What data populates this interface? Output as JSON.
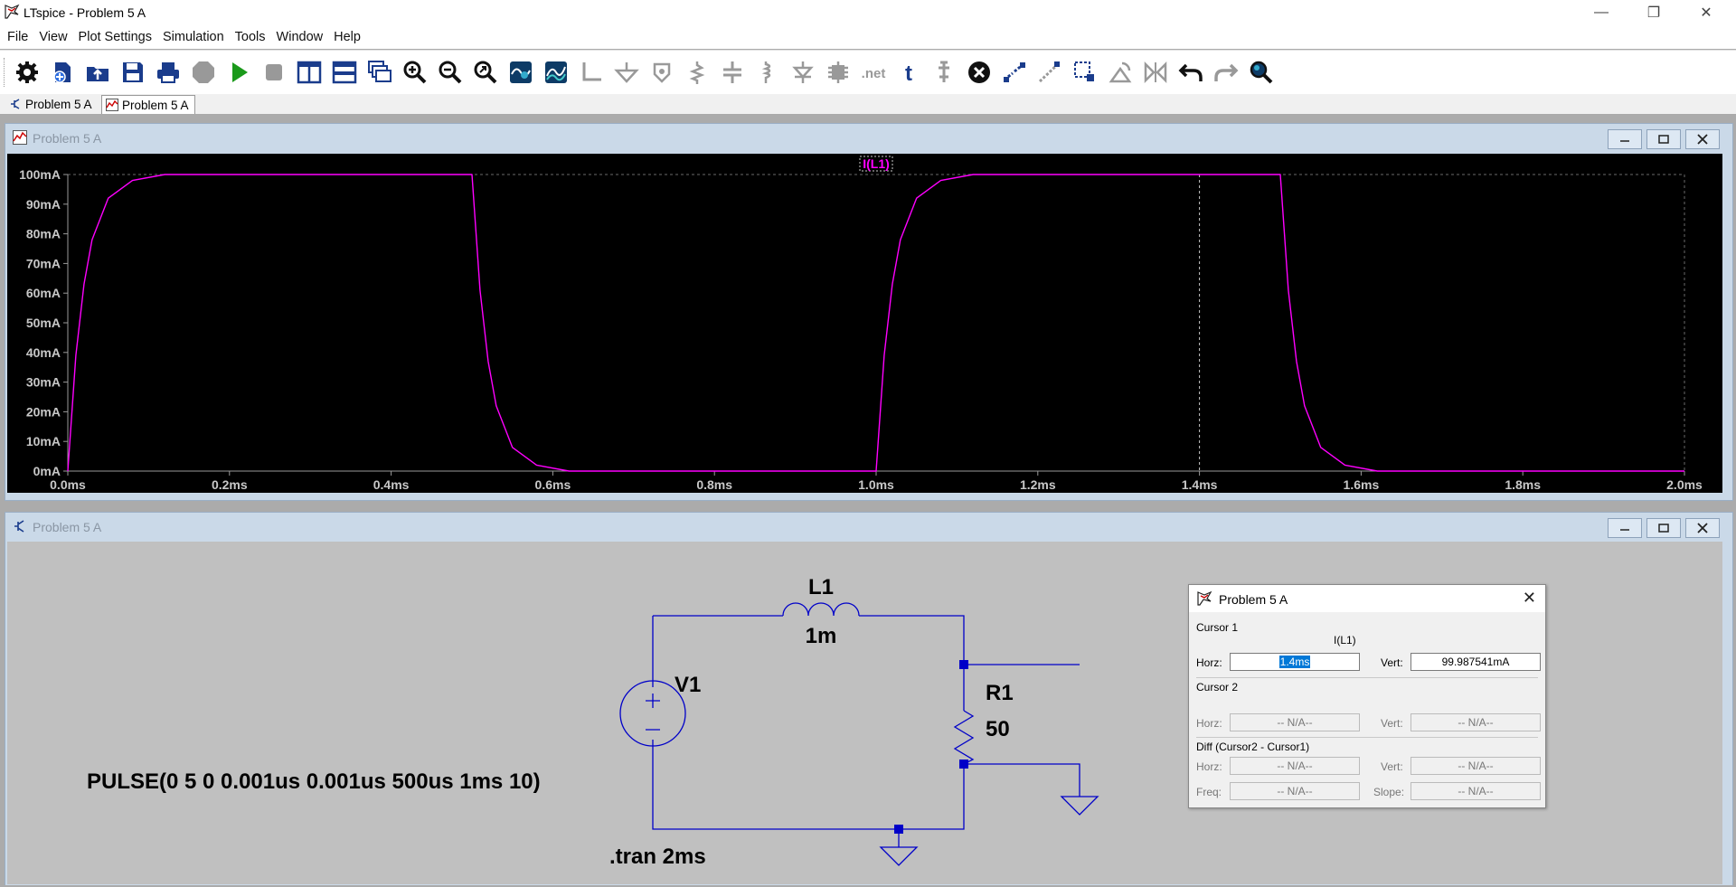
{
  "window": {
    "title": "LTspice - Problem 5 A"
  },
  "menu": [
    "File",
    "View",
    "Plot Settings",
    "Simulation",
    "Tools",
    "Window",
    "Help"
  ],
  "tabs": [
    {
      "label": "Problem 5 A",
      "kind": "schematic"
    },
    {
      "label": "Problem 5 A",
      "kind": "waveform",
      "active": true
    }
  ],
  "plot_window": {
    "title": "Problem 5 A"
  },
  "schematic_window": {
    "title": "Problem 5 A"
  },
  "chart_data": {
    "type": "line",
    "trace_label": "I(L1)",
    "trace_color": "#ff00ff",
    "background": "#000000",
    "xlabel": "",
    "ylabel": "",
    "xlim": [
      0,
      2.0
    ],
    "ylim": [
      0,
      100
    ],
    "x_ticks": [
      "0.0ms",
      "0.2ms",
      "0.4ms",
      "0.6ms",
      "0.8ms",
      "1.0ms",
      "1.2ms",
      "1.4ms",
      "1.6ms",
      "1.8ms",
      "2.0ms"
    ],
    "y_ticks": [
      "0mA",
      "10mA",
      "20mA",
      "30mA",
      "40mA",
      "50mA",
      "60mA",
      "70mA",
      "80mA",
      "90mA",
      "100mA"
    ],
    "cursor_x": 1.4,
    "series": [
      {
        "name": "I(L1)",
        "x_unit": "ms",
        "y_unit": "mA",
        "x": [
          0.0,
          0.01,
          0.02,
          0.03,
          0.05,
          0.08,
          0.12,
          0.5,
          0.51,
          0.52,
          0.53,
          0.55,
          0.58,
          0.62,
          1.0,
          1.01,
          1.02,
          1.03,
          1.05,
          1.08,
          1.12,
          1.5,
          1.51,
          1.52,
          1.53,
          1.55,
          1.58,
          1.62,
          2.0
        ],
        "y": [
          0,
          39,
          63,
          78,
          92,
          98,
          100,
          100,
          61,
          37,
          22,
          8,
          2,
          0,
          0,
          39,
          63,
          78,
          92,
          98,
          100,
          100,
          61,
          37,
          22,
          8,
          2,
          0,
          0
        ]
      }
    ]
  },
  "schematic": {
    "inductor": {
      "name": "L1",
      "value": "1m"
    },
    "source": {
      "name": "V1",
      "value": "PULSE(0 5 0 0.001us 0.001us 500us 1ms 10)"
    },
    "resistor": {
      "name": "R1",
      "value": "50"
    },
    "directive": ".tran 2ms"
  },
  "cursor_dialog": {
    "title": "Problem 5 A",
    "cursor1_label": "Cursor 1",
    "trace": "I(L1)",
    "horz_label": "Horz:",
    "vert_label": "Vert:",
    "c1_horz": "1.4ms",
    "c1_vert": "99.987541mA",
    "cursor2_label": "Cursor 2",
    "c2_horz": "-- N/A--",
    "c2_vert": "-- N/A--",
    "diff_label": "Diff (Cursor2 - Cursor1)",
    "diff_horz": "-- N/A--",
    "diff_vert": "-- N/A--",
    "freq_label": "Freq:",
    "freq": "-- N/A--",
    "slope_label": "Slope:",
    "slope": "-- N/A--"
  }
}
